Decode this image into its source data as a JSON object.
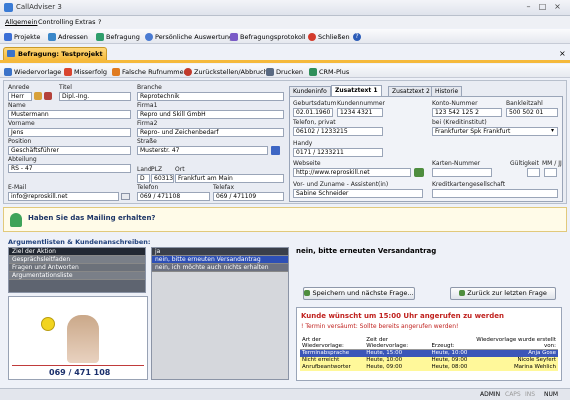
{
  "app": {
    "title": "CallAdviser 3"
  },
  "menu": [
    "Allgemein",
    "Controlling",
    "Extras",
    "?"
  ],
  "toolbar": [
    {
      "label": "Projekte",
      "icon": "projects-icon",
      "color": "#3b6fd6"
    },
    {
      "label": "Adressen",
      "icon": "address-icon",
      "color": "#3a87c9"
    },
    {
      "label": "Befragung",
      "icon": "survey-icon",
      "color": "#2f9e6b"
    },
    {
      "label": "Persönliche Auswertung",
      "icon": "chart-icon",
      "color": "#4a7bd2"
    },
    {
      "label": "Befragungsprotokoll",
      "icon": "protocol-icon",
      "color": "#7a5bc7"
    },
    {
      "label": "Schließen",
      "icon": "close-icon",
      "color": "#d33b2c"
    },
    {
      "label": "",
      "icon": "help-icon",
      "color": "#2a5bb8"
    }
  ],
  "doc_tab": "Befragung: Testprojekt",
  "toolbar2": [
    {
      "label": "Wiedervorlage",
      "icon": "calendar-icon",
      "color": "#3b73c8"
    },
    {
      "label": "Misserfolg",
      "icon": "failure-icon",
      "color": "#d9452f"
    },
    {
      "label": "Falsche Rufnummer",
      "icon": "wrong-number-icon",
      "color": "#e07b20"
    },
    {
      "label": "Zurückstellen/Abbruch",
      "icon": "cancel-icon",
      "color": "#c23a2b"
    },
    {
      "label": "Drucken",
      "icon": "print-icon",
      "color": "#5a6a82"
    },
    {
      "label": "CRM-Plus",
      "icon": "crm-icon",
      "color": "#2f8f5a"
    }
  ],
  "form": {
    "anrede": {
      "label": "Anrede",
      "value": "Herr"
    },
    "titel": {
      "label": "Titel",
      "value": "Dipl.-Ing."
    },
    "branche": {
      "label": "Branche",
      "value": "Reprotechnik"
    },
    "name": {
      "label": "Name",
      "value": "Mustermann"
    },
    "firma1": {
      "label": "Firma1",
      "value": "Repro und Skill GmbH"
    },
    "vorname": {
      "label": "Vorname",
      "value": "Jens"
    },
    "firma2": {
      "label": "Firma2",
      "value": "Repro- und Zeichenbedarf"
    },
    "position": {
      "label": "Position",
      "value": "Geschäftsführer"
    },
    "strasse": {
      "label": "Straße",
      "value": "Musterstr. 47"
    },
    "abteilung": {
      "label": "Abteilung",
      "value": "RS - 47"
    },
    "land": {
      "label": "Land",
      "value": "D"
    },
    "plz": {
      "label": "PLZ",
      "value": "60313"
    },
    "ort": {
      "label": "Ort",
      "value": "Frankfurt am Main"
    },
    "email": {
      "label": "E-Mail",
      "value": "info@reproskill.net"
    },
    "telefon": {
      "label": "Telefon",
      "value": "069 / 471108"
    },
    "telefax": {
      "label": "Telefax",
      "value": "069 / 471109"
    }
  },
  "tabs": [
    "Kundeninfo",
    "Zusatztext 1",
    "Zusatztext 2",
    "Historie"
  ],
  "right": {
    "geburtsdatum": {
      "label": "Geburtsdatum",
      "value": "02.01.1960"
    },
    "kundennummer": {
      "label": "Kundennummer",
      "value": "1234 4321"
    },
    "konto": {
      "label": "Konto-Nummer",
      "value": "123 542 125 2"
    },
    "blz": {
      "label": "Bankleitzahl",
      "value": "500 502 01"
    },
    "telprivat": {
      "label": "Telefon, privat",
      "value": "06102 / 1233215"
    },
    "bei": {
      "label": "bei (Kreditinstitut)",
      "value": "Frankfurter Spk Frankfurt"
    },
    "handy": {
      "label": "Handy",
      "value": "0171 / 1233211"
    },
    "webseite": {
      "label": "Webseite",
      "value": "http://www.reproskill.net"
    },
    "karte": {
      "label": "Karten-Nummer",
      "value": ""
    },
    "gueltig": {
      "label": "Gültigkeit",
      "value": ""
    },
    "mmjj": {
      "label": "MM / JJ",
      "value": ""
    },
    "assistent": {
      "label": "Vor- und Zuname - Assistent(in)",
      "value": "Sabine Schneider"
    },
    "kreditgesell": {
      "label": "Kreditkartengesellschaft",
      "value": ""
    }
  },
  "mailing_question": "Haben Sie das Mailing erhalten?",
  "section_title": "Argumentlisten & Kundenanschreiben:",
  "arguments": [
    "Ziel der Aktion",
    "Gesprächsleitfaden",
    "Fragen und Antworten",
    "Argumentationsliste"
  ],
  "answers": [
    "ja",
    "nein, bitte erneuten Versandantrag",
    "nein, ich möchte auch nichts erhalten"
  ],
  "selected_answer": "nein, bitte erneuten Versandantrag",
  "agent_phone": "069 / 471 108",
  "buttons": {
    "next": "Speichern und nächste Frage...",
    "back": "Zurück zur letzten Frage"
  },
  "callback": {
    "title": "Kunde wünscht um 15:00 Uhr angerufen zu werden",
    "warning": "! Termin versäumt: Sollte bereits angerufen werden!",
    "headers": [
      "Art der Wiedervorlage:",
      "Zeit der Wiedervorlage:",
      "Erzeugt:",
      "Wiedervorlage wurde erstellt von:"
    ],
    "rows": [
      {
        "art": "Terminabsprache",
        "zeit": "Heute, 15:00",
        "erzeugt": "Heute, 10:00",
        "von": "Anja Gose",
        "bg": "#3b56b8",
        "fg": "#ffffff"
      },
      {
        "art": "Nicht erreicht",
        "zeit": "Heute, 10:00",
        "erzeugt": "Heute, 09:00",
        "von": "Nicole Seyfert",
        "bg": "#fff89a",
        "fg": "#000000"
      },
      {
        "art": "Anrufbeantworter",
        "zeit": "Heute, 09:00",
        "erzeugt": "Heute, 08:00",
        "von": "Marina Wehlich",
        "bg": "#fff89a",
        "fg": "#000000"
      }
    ]
  },
  "status": [
    "ADMIN",
    "CAPS",
    "INS",
    "NUM"
  ]
}
